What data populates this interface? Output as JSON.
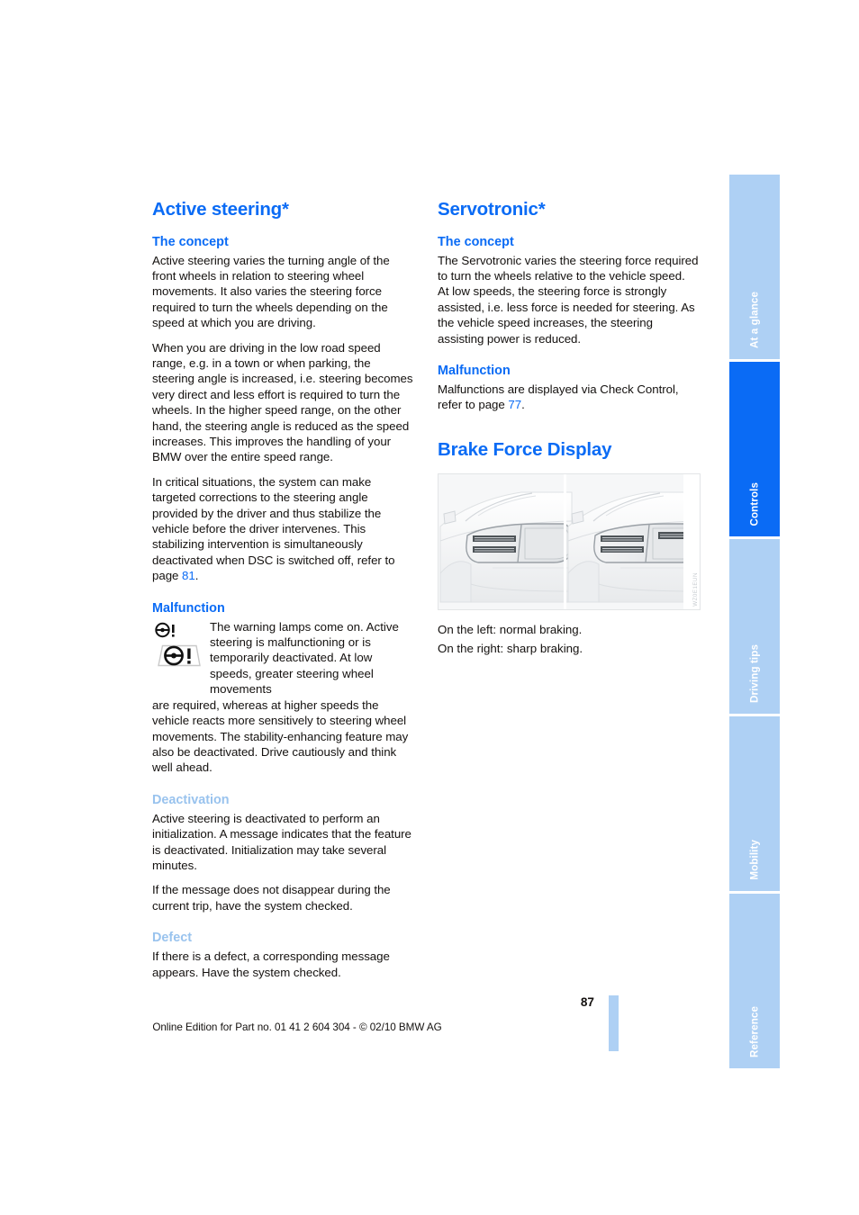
{
  "document": {
    "page_number": "87",
    "footer_note": "Online Edition for Part no. 01 41 2 604 304 - © 02/10 BMW AG"
  },
  "colors": {
    "heading_blue": "#0a6bf5",
    "subheading_light_blue": "#99c3ee",
    "tab_inactive": "#aed0f4",
    "tab_active": "#0a6bf5",
    "body_text": "#14110f"
  },
  "left_column": {
    "title": "Active steering*",
    "sections": [
      {
        "heading": "The concept",
        "heading_style": "blue",
        "paragraphs": [
          "Active steering varies the turning angle of the front wheels in relation to steering wheel movements. It also varies the steering force required to turn the wheels depending on the speed at which you are driving.",
          "When you are driving in the low road speed range, e.g. in a town or when parking, the steering angle is increased, i.e. steering becomes very direct and less effort is required to turn the wheels. In the higher speed range, on the other hand, the steering angle is reduced as the speed increases. This improves the handling of your BMW over the entire speed range.",
          "In critical situations, the system can make targeted corrections to the steering angle provided by the driver and thus stabilize the vehicle before the driver intervenes. This stabilizing intervention is simultaneously deactivated when DSC is switched off, refer to page "
        ],
        "page_link": "81",
        "page_link_suffix": "."
      }
    ],
    "malfunction": {
      "heading": "Malfunction",
      "icon_names": [
        "steering-wheel-warning-small-icon",
        "steering-wheel-warning-large-icon"
      ],
      "text_beside_icons": "The warning lamps come on. Active steering is malfunctioning or is temporarily deactivated. At low speeds, greater steering wheel movements",
      "text_below_icons": "are required, whereas at higher speeds the vehicle reacts more sensitively to steering wheel movements. The stability-enhancing feature may also be deactivated. Drive cautiously and think well ahead."
    },
    "deactivation": {
      "heading": "Deactivation",
      "paragraphs": [
        "Active steering is deactivated to perform an initialization. A message indicates that the feature is deactivated. Initialization may take several minutes.",
        "If the message does not disappear during the current trip, have the system checked."
      ]
    },
    "defect": {
      "heading": "Defect",
      "paragraphs": [
        "If there is a defect, a corresponding message appears. Have the system checked."
      ]
    }
  },
  "right_column": {
    "title": "Servotronic*",
    "concept": {
      "heading": "The concept",
      "paragraphs": [
        "The Servotronic varies the steering force required to turn the wheels relative to the vehicle speed.",
        "At low speeds, the steering force is strongly assisted, i.e. less force is needed for steering. As the vehicle speed increases, the steering assisting power is reduced."
      ]
    },
    "malfunction": {
      "heading": "Malfunction",
      "text_prefix": "Malfunctions are displayed via Check Control, refer to page ",
      "page_link": "77",
      "text_suffix": "."
    },
    "brake_force_display": {
      "title": "Brake Force Display",
      "figure_code": "WZ0E1EUN",
      "figure_alt": "rear-view-brake-lights-illustration",
      "caption_lines": [
        "On the left: normal braking.",
        "On the right: sharp braking."
      ]
    }
  },
  "sidebar": {
    "tabs": [
      {
        "label": "At a glance",
        "active": false
      },
      {
        "label": "Controls",
        "active": true
      },
      {
        "label": "Driving tips",
        "active": false
      },
      {
        "label": "Mobility",
        "active": false
      },
      {
        "label": "Reference",
        "active": false
      }
    ]
  }
}
